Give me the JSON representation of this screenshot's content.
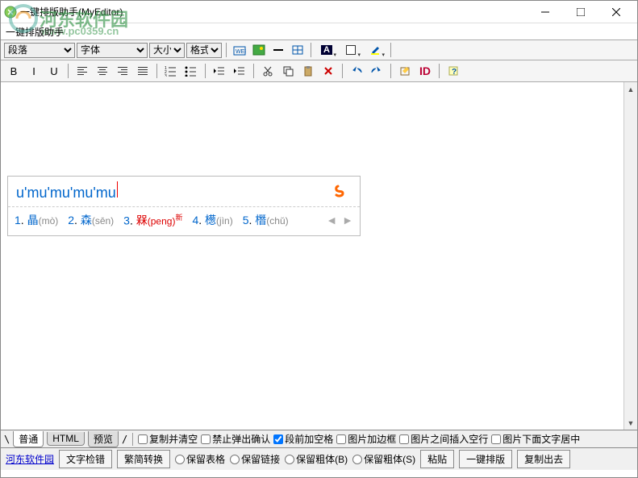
{
  "window": {
    "title": "一键排版助手(MyEditor)"
  },
  "watermark": {
    "text": "河东软件园",
    "url": "www.pc0359.cn"
  },
  "menubar": {
    "label": "一键排版助手"
  },
  "toolbar1": {
    "paragraph": "段落",
    "font": "字体",
    "size": "大小",
    "format": "格式"
  },
  "ime": {
    "input": "u'mu'mu'mu'mu",
    "candidates": [
      {
        "n": "1",
        "ch": "晶",
        "py": "(mò)"
      },
      {
        "n": "2",
        "ch": "森",
        "py": "(sēn)"
      },
      {
        "n": "3",
        "ch": "槑",
        "py": "(peng)"
      },
      {
        "n": "4",
        "ch": "檧",
        "py": "(jìn)"
      },
      {
        "n": "5",
        "ch": "橬",
        "py": "(chǔ)"
      }
    ]
  },
  "tabs": {
    "t1": "普通",
    "t2": "HTML",
    "t3": "预览"
  },
  "checks": {
    "c1": "复制并清空",
    "c2": "禁止弹出确认",
    "c3": "段前加空格",
    "c4": "图片加边框",
    "c5": "图片之间插入空行",
    "c6": "图片下面文字居中"
  },
  "bottom": {
    "link": "河东软件园",
    "b1": "文字检错",
    "b2": "繁简转换",
    "r1": "保留表格",
    "r2": "保留链接",
    "r3": "保留粗体(B)",
    "r4": "保留粗体(S)",
    "b3": "粘贴",
    "b4": "一键排版",
    "b5": "复制出去"
  }
}
